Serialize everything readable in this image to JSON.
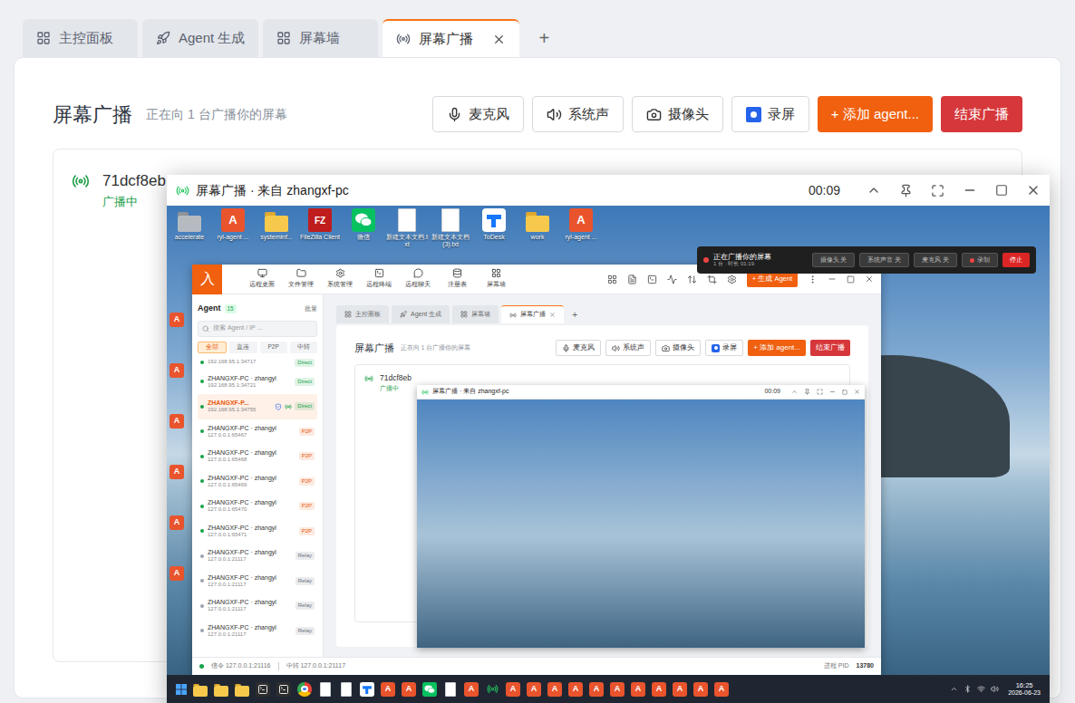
{
  "tabs": [
    {
      "label": "主控面板",
      "selected": false
    },
    {
      "label": "Agent 生成",
      "selected": false
    },
    {
      "label": "屏幕墙",
      "selected": false
    },
    {
      "label": "屏幕广播",
      "selected": true
    }
  ],
  "add_tab": "+",
  "page": {
    "title": "屏幕广播",
    "subtitle": "正在向 1 台广播你的屏幕",
    "buttons": [
      {
        "label": "麦克风",
        "kind": "mic"
      },
      {
        "label": "系统声",
        "kind": "speaker"
      },
      {
        "label": "摄像头",
        "kind": "camera"
      },
      {
        "label": "录屏",
        "kind": "record"
      },
      {
        "label": "+ 添加 agent...",
        "kind": "primary"
      },
      {
        "label": "结束广播",
        "kind": "danger"
      }
    ],
    "target": {
      "id": "71dcf8eb",
      "status": "广播中"
    }
  },
  "viewer": {
    "title": "屏幕广播 · 来自 zhangxf-pc",
    "timer": "00:09"
  },
  "remote": {
    "desktop_icons": [
      {
        "label": "accelerate",
        "kind": "folder-gray",
        "glyph": ""
      },
      {
        "label": "ryl-agent ...",
        "kind": "ryl",
        "glyph": "A"
      },
      {
        "label": "systeminf...",
        "kind": "folder",
        "glyph": ""
      },
      {
        "label": "FileZilla Client",
        "kind": "filezilla",
        "glyph": "FZ"
      },
      {
        "label": "微信",
        "kind": "wechat",
        "glyph": ""
      },
      {
        "label": "新建文本文档.txt",
        "kind": "doc",
        "glyph": ""
      },
      {
        "label": "新建文本文档 (3).txt",
        "kind": "doc",
        "glyph": ""
      },
      {
        "label": "ToDesk",
        "kind": "todesk",
        "glyph": ""
      },
      {
        "label": "work",
        "kind": "folder",
        "glyph": ""
      },
      {
        "label": "ryl-agent ...",
        "kind": "ryl",
        "glyph": "A"
      }
    ],
    "column_icons": [
      {
        "kind": "ryl",
        "glyph": "A"
      },
      {
        "kind": "ryl",
        "glyph": "A"
      },
      {
        "kind": "ryl",
        "glyph": "A"
      },
      {
        "kind": "ryl",
        "glyph": "A"
      },
      {
        "kind": "ryl",
        "glyph": "A"
      },
      {
        "kind": "ryl",
        "glyph": "A"
      }
    ],
    "app": {
      "logo": "入",
      "nav": [
        "远程桌面",
        "文件管理",
        "系统管理",
        "远程终端",
        "远程聊天",
        "注册表",
        "屏幕墙"
      ],
      "generate": "+ 生成 Agent",
      "sidebar": {
        "title": "Agent",
        "count": "15",
        "batch": "批量",
        "search_placeholder": "搜索 Agent / IP ...",
        "filters": [
          {
            "label": "全部",
            "selected": true
          },
          {
            "label": "直连",
            "selected": false
          },
          {
            "label": "P2P",
            "selected": false
          },
          {
            "label": "中转",
            "selected": false
          }
        ],
        "agents": [
          {
            "name": "",
            "addr": "192.168.95.1:34717",
            "mode": "Direct",
            "color": "#16a34a",
            "selected": false,
            "verified": false,
            "broadcasting": false
          },
          {
            "name": "ZHANGXF-PC · zhangyl",
            "addr": "192.168.95.1:34721",
            "mode": "Direct",
            "color": "#16a34a",
            "selected": false,
            "verified": false,
            "broadcasting": false
          },
          {
            "name": "ZHANGXF-P...",
            "addr": "192.168.95.1:34755",
            "mode": "Direct",
            "color": "#16a34a",
            "selected": true,
            "verified": true,
            "broadcasting": true
          },
          {
            "name": "ZHANGXF-PC · zhangyl",
            "addr": "127.0.0.1:65467",
            "mode": "P2P",
            "color": "#ea580c",
            "selected": false,
            "verified": false,
            "broadcasting": false
          },
          {
            "name": "ZHANGXF-PC · zhangyl",
            "addr": "127.0.0.1:65468",
            "mode": "P2P",
            "color": "#ea580c",
            "selected": false,
            "verified": false,
            "broadcasting": false
          },
          {
            "name": "ZHANGXF-PC · zhangyl",
            "addr": "127.0.0.1:65469",
            "mode": "P2P",
            "color": "#ea580c",
            "selected": false,
            "verified": false,
            "broadcasting": false
          },
          {
            "name": "ZHANGXF-PC · zhangyl",
            "addr": "127.0.0.1:65470",
            "mode": "P2P",
            "color": "#ea580c",
            "selected": false,
            "verified": false,
            "broadcasting": false
          },
          {
            "name": "ZHANGXF-PC · zhangyl",
            "addr": "127.0.0.1:65471",
            "mode": "P2P",
            "color": "#ea580c",
            "selected": false,
            "verified": false,
            "broadcasting": false
          },
          {
            "name": "ZHANGXF-PC · zhangyl",
            "addr": "127.0.0.1:21117",
            "mode": "Relay",
            "color": "#6b7280",
            "selected": false,
            "verified": false,
            "broadcasting": false
          },
          {
            "name": "ZHANGXF-PC · zhangyl",
            "addr": "127.0.0.1:21117",
            "mode": "Relay",
            "color": "#6b7280",
            "selected": false,
            "verified": false,
            "broadcasting": false
          },
          {
            "name": "ZHANGXF-PC · zhangyl",
            "addr": "127.0.0.1:21117",
            "mode": "Relay",
            "color": "#6b7280",
            "selected": false,
            "verified": false,
            "broadcasting": false
          },
          {
            "name": "ZHANGXF-PC · zhangyl",
            "addr": "127.0.0.1:21117",
            "mode": "Relay",
            "color": "#6b7280",
            "selected": false,
            "verified": false,
            "broadcasting": false
          }
        ]
      },
      "tabs": [
        {
          "label": "主控面板",
          "selected": false
        },
        {
          "label": "Agent 生成",
          "selected": false
        },
        {
          "label": "屏幕墙",
          "selected": false
        },
        {
          "label": "屏幕广播",
          "selected": true
        }
      ],
      "add_tab": "+",
      "page": {
        "title": "屏幕广播",
        "subtitle": "正在向 1 台广播你的屏幕",
        "buttons": [
          {
            "label": "麦克风",
            "kind": "mic"
          },
          {
            "label": "系统声",
            "kind": "speaker"
          },
          {
            "label": "摄像头",
            "kind": "camera"
          },
          {
            "label": "录屏",
            "kind": "record"
          },
          {
            "label": "+ 添加 agent...",
            "kind": "primary"
          },
          {
            "label": "结束广播",
            "kind": "danger"
          }
        ],
        "target": {
          "id": "71dcf8eb",
          "status": "广播中"
        }
      },
      "status_bar": {
        "signal": "信令 127.0.0.1:21116",
        "relay": "中转 127.0.0.1:21117",
        "pid_label": "进程 PID",
        "pid": "13780"
      }
    },
    "float_bar": {
      "title": "正在广播你的屏幕",
      "detail": "1 台 · 时长 01:19",
      "buttons": [
        {
          "label": "摄像头 关",
          "kind": "toggle"
        },
        {
          "label": "系统声音 关",
          "kind": "toggle"
        },
        {
          "label": "麦克风 关",
          "kind": "toggle"
        },
        {
          "label": "录制",
          "kind": "record"
        },
        {
          "label": "停止",
          "kind": "stop"
        }
      ]
    },
    "viewer": {
      "title": "屏幕广播 · 来自 zhangxf-pc",
      "timer": "00:09"
    },
    "taskbar": {
      "items": [
        {
          "kind": "folder",
          "glyph": ""
        },
        {
          "kind": "folder",
          "glyph": ""
        },
        {
          "kind": "folder",
          "glyph": ""
        },
        {
          "kind": "terminal",
          "glyph": ""
        },
        {
          "kind": "terminal",
          "glyph": ""
        },
        {
          "kind": "chrome",
          "glyph": ""
        },
        {
          "kind": "doc",
          "glyph": ""
        },
        {
          "kind": "doc",
          "glyph": ""
        },
        {
          "kind": "todesk",
          "glyph": ""
        },
        {
          "kind": "ryl",
          "glyph": "A"
        },
        {
          "kind": "ryl",
          "glyph": "A"
        },
        {
          "kind": "wechat",
          "glyph": ""
        },
        {
          "kind": "doc",
          "glyph": ""
        },
        {
          "kind": "ryl",
          "glyph": "A"
        },
        {
          "kind": "broadcast",
          "glyph": ""
        },
        {
          "kind": "ryl",
          "glyph": "A"
        },
        {
          "kind": "ryl",
          "glyph": "A"
        },
        {
          "kind": "ryl",
          "glyph": "A"
        },
        {
          "kind": "ryl",
          "glyph": "A"
        },
        {
          "kind": "ryl",
          "glyph": "A"
        },
        {
          "kind": "ryl",
          "glyph": "A"
        },
        {
          "kind": "ryl",
          "glyph": "A"
        },
        {
          "kind": "ryl",
          "glyph": "A"
        },
        {
          "kind": "ryl",
          "glyph": "A"
        },
        {
          "kind": "ryl",
          "glyph": "A"
        },
        {
          "kind": "ryl",
          "glyph": "A"
        }
      ],
      "time": "16:25",
      "date": "2026-06-23"
    }
  }
}
